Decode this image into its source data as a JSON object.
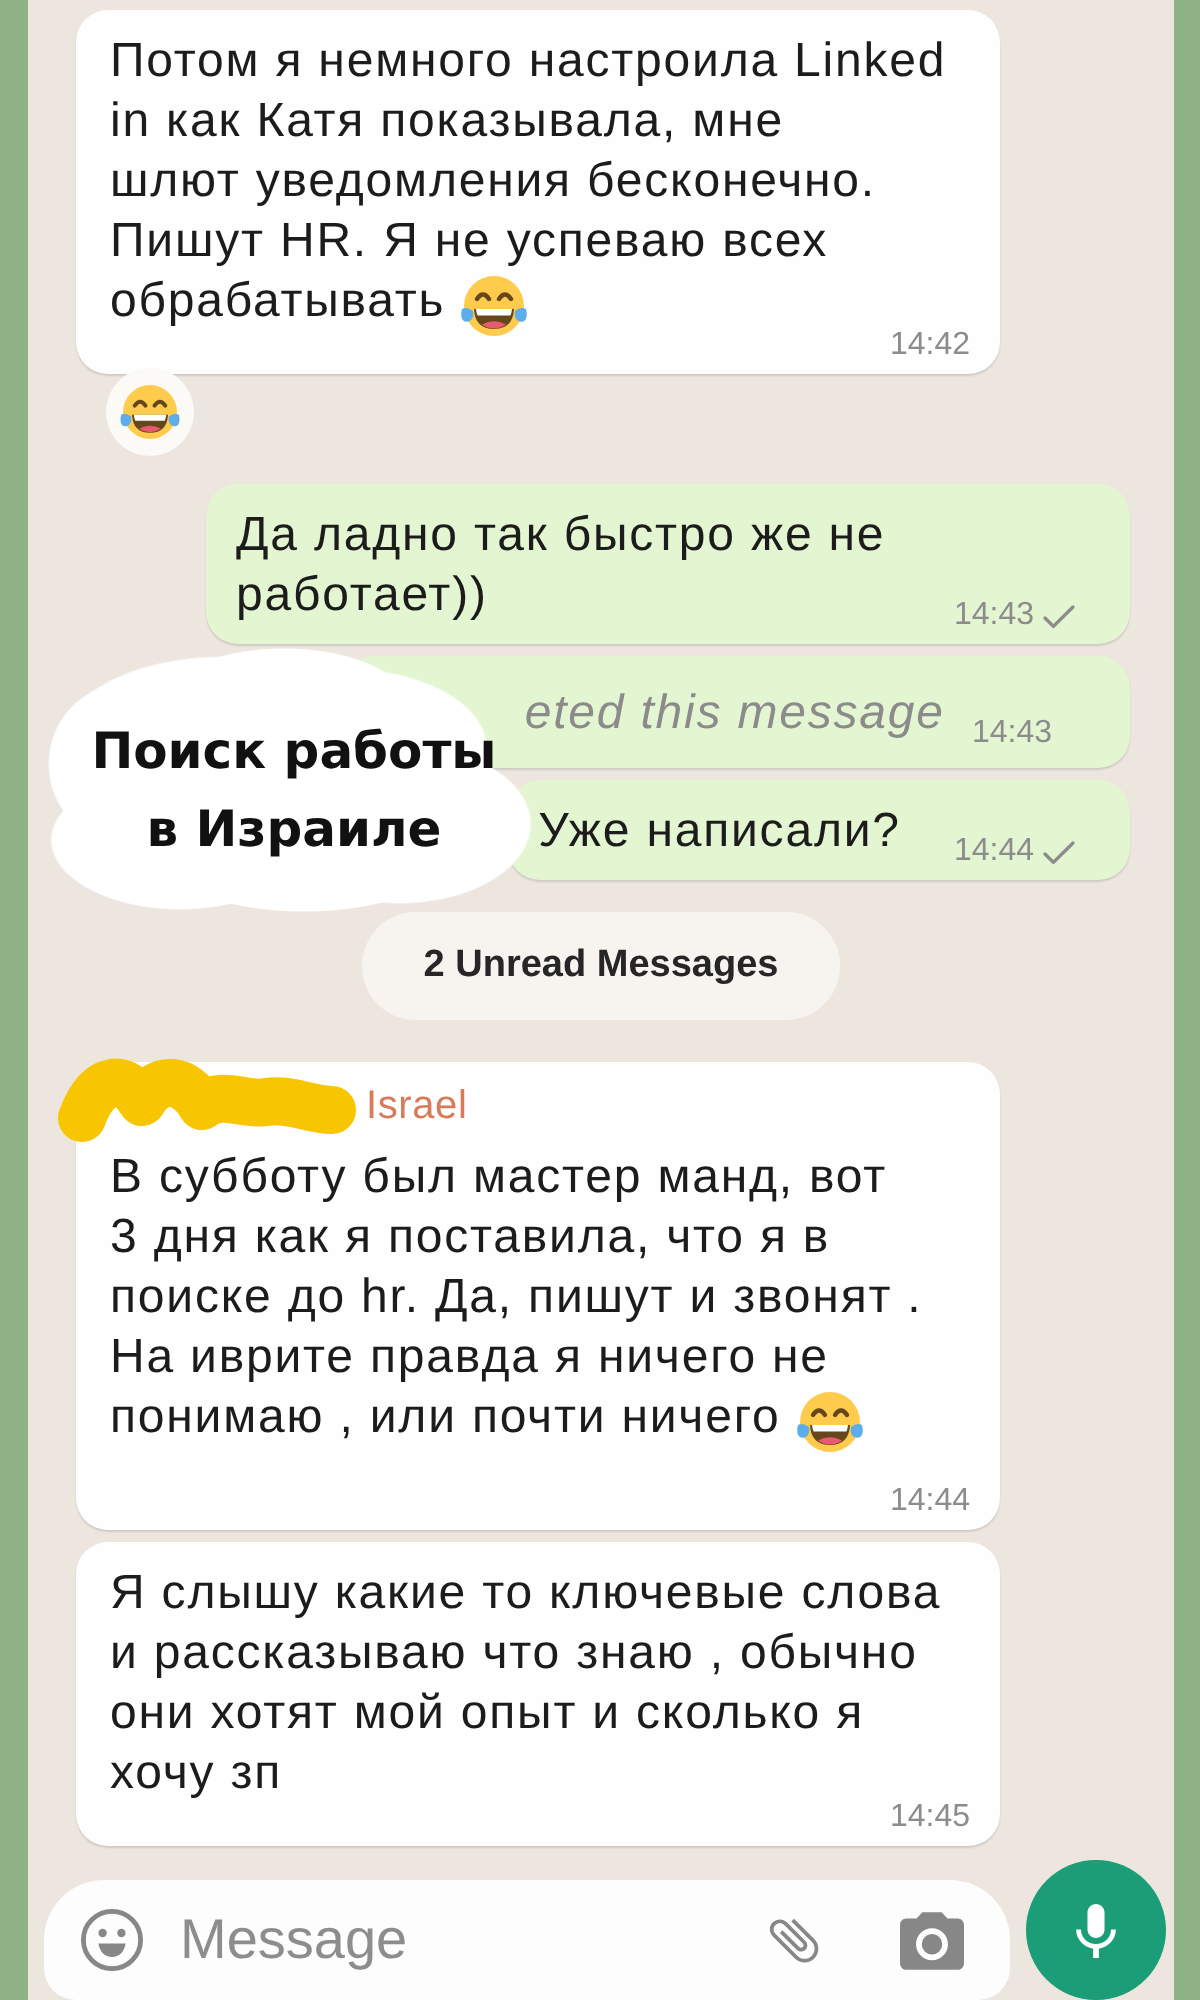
{
  "messages": [
    {
      "kind": "text",
      "outgoing": false,
      "text": "Потом я немного настроила Linked\nin как Катя показывала, мне\nшлют уведомления бесконечно.\nПишут HR. Я не успеваю всех\nобрабатывать",
      "trailing_emoji": true,
      "time": "14:42",
      "sent": false,
      "reaction": true
    },
    {
      "kind": "text",
      "outgoing": true,
      "text": "Да ладно так быстро же не\nработает))",
      "time": "14:43",
      "sent": true
    },
    {
      "kind": "deleted",
      "outgoing": true,
      "text": "eted this message",
      "time": "14:43",
      "sent": false
    },
    {
      "kind": "text",
      "outgoing": true,
      "text": "Уже написали?",
      "time": "14:44",
      "sent": true
    },
    {
      "kind": "unread_banner",
      "text": "2 Unread Messages"
    },
    {
      "kind": "text",
      "outgoing": false,
      "sender": "Israel",
      "sender_redacted": true,
      "text": "В субботу был мастер манд, вот\n3 дня как я поставила, что я в\nпоиске до hr. Да, пишут и звонят .\nНа иврите правда я ничего не\nпонимаю , или почти ничего",
      "trailing_emoji": true,
      "time": "14:44",
      "sent": false
    },
    {
      "kind": "text",
      "outgoing": false,
      "text": "Я слышу какие то ключевые слова\nи рассказываю что знаю , обычно\nони хотят мой опыт и сколько я\nхочу зп",
      "time": "14:45",
      "sent": false
    }
  ],
  "overlay_caption": {
    "text": "Поиск работы\nв Израиле"
  },
  "composer": {
    "placeholder": "Message"
  }
}
